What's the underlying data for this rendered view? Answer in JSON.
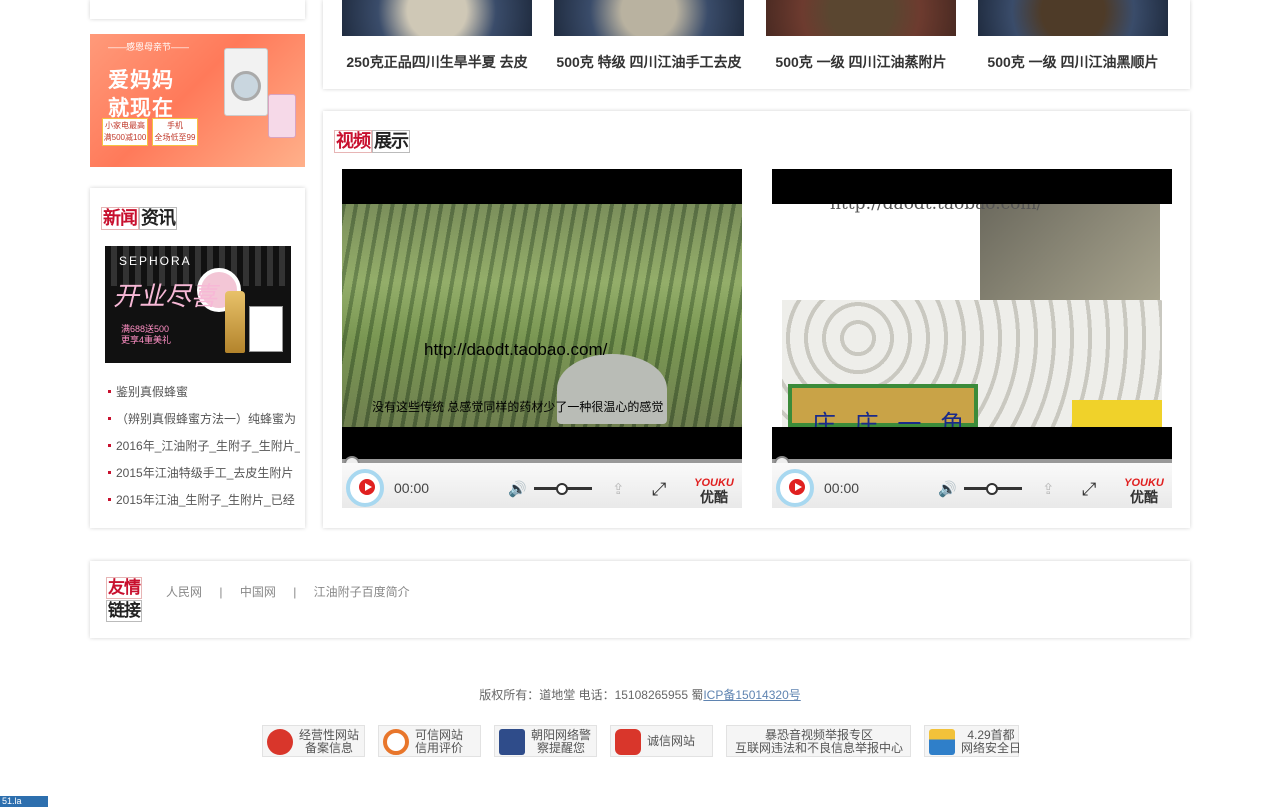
{
  "products": [
    {
      "name": "250克正品四川生旱半夏 去皮"
    },
    {
      "name": "500克 特级 四川江油手工去皮"
    },
    {
      "name": "500克 一级 四川江油蒸附片"
    },
    {
      "name": "500克 一级 四川江油黑顺片"
    }
  ],
  "banner_mom": {
    "subtitle": "——感恩母亲节——",
    "line1": "爱妈妈",
    "line2": "就现在",
    "box1_line1": "小家电最高",
    "box1_line2": "满500减100",
    "box2_line1": "手机",
    "box2_line2": "全场低至99"
  },
  "news": {
    "title_a": "新闻",
    "title_b": "资讯",
    "ad": {
      "brand": "SEPHORA",
      "headline": "开业尽喜",
      "promo1": "满688送500",
      "promo2": "更享4重美礼"
    },
    "items": [
      "鉴别真假蜂蜜",
      "（辨别真假蜂蜜方法一）纯蜂蜜为",
      "2016年_江油附子_生附子_生附片_",
      "2015年江油特级手工_去皮生附片",
      "2015年江油_生附子_生附片_已经"
    ]
  },
  "video_section": {
    "title_a": "视频",
    "title_b": "展示",
    "videos": [
      {
        "overlay_url": "http://daodt.taobao.com/",
        "overlay_caption": "没有这些传统  总感觉同样的药材少了一种很温心的感觉",
        "time": "00:00",
        "logo_top": "YOUKU",
        "logo_bottom": "优酷"
      },
      {
        "overlay_url": "http://daodt.taobao.com/",
        "overlay_caption": "庄 庄 一 角",
        "time": "00:00",
        "logo_top": "YOUKU",
        "logo_bottom": "优酷"
      }
    ]
  },
  "links": {
    "title_a": "友情",
    "title_b": "链接",
    "items": [
      "人民网",
      "中国网",
      "江油附子百度简介"
    ],
    "separator": "|"
  },
  "footer": {
    "copyright": "版权所有：道地堂  电话：15108265955 蜀",
    "icp": "ICP备15014320号",
    "badges": [
      {
        "line1": "经营性网站",
        "line2": "备案信息",
        "color": "#d9362b"
      },
      {
        "line1": "可信网站",
        "line2": "信用评价",
        "color": "#e8762b"
      },
      {
        "line1": "朝阳网络警",
        "line2": "察提醒您",
        "color": "#2f4c8a"
      },
      {
        "line1": "诚信网站",
        "line2": "",
        "color": "#d9362b"
      },
      {
        "line1": "暴恐音视频举报专区",
        "line2": "互联网违法和不良信息举报中心",
        "color": ""
      },
      {
        "line1": "4.29首都",
        "line2": "网络安全日",
        "color": "#2f7fc9"
      }
    ],
    "stat_label": "51.la"
  }
}
